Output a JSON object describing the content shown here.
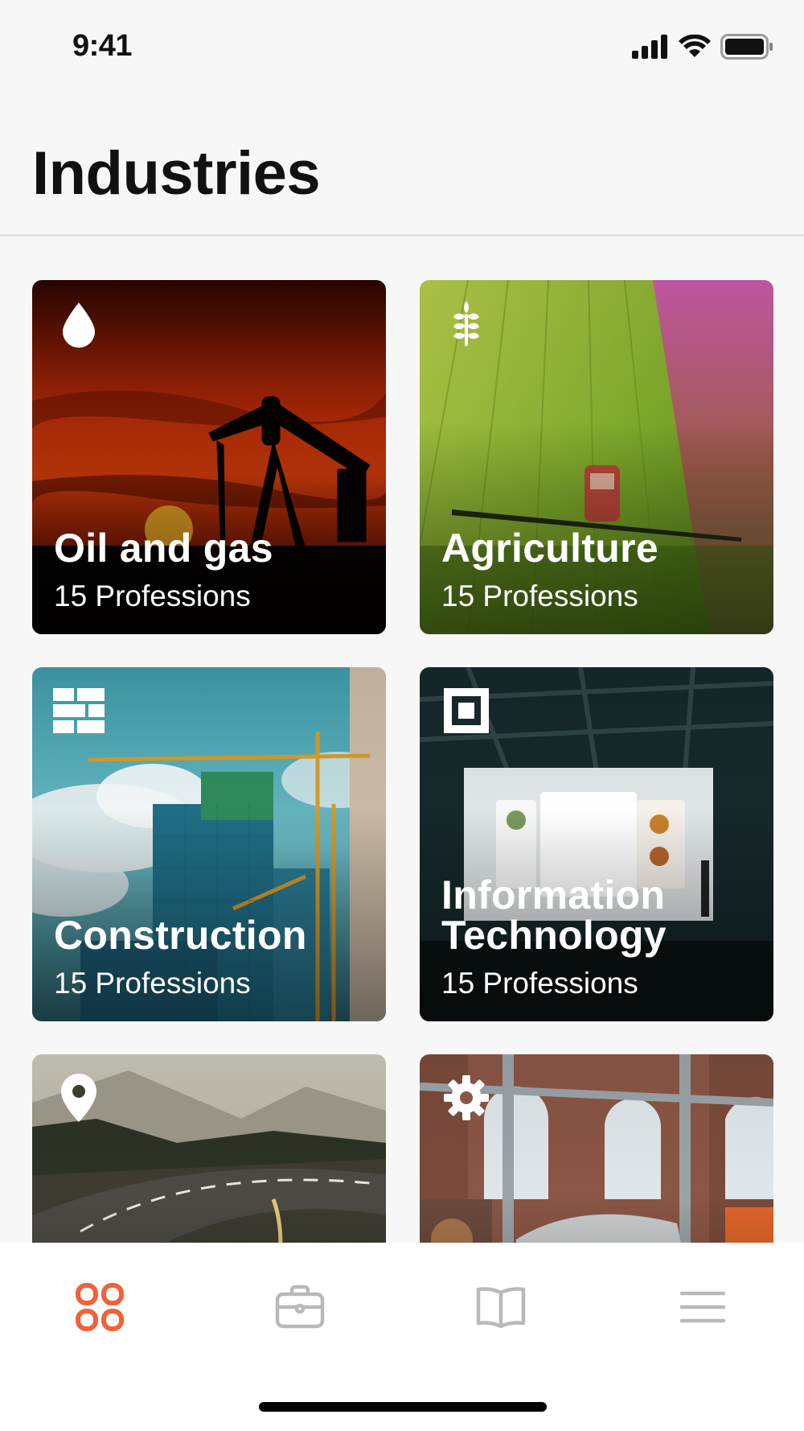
{
  "status_bar": {
    "time": "9:41"
  },
  "header": {
    "title": "Industries"
  },
  "industries": [
    {
      "name": "Oil and gas",
      "count": "15 Professions",
      "icon": "drop-icon"
    },
    {
      "name": "Agriculture",
      "count": "15 Professions",
      "icon": "wheat-icon"
    },
    {
      "name": "Construction",
      "count": "15 Professions",
      "icon": "bricks-icon"
    },
    {
      "name": "Information Technology",
      "count": "15 Professions",
      "icon": "square-chip-icon"
    },
    {
      "name": "",
      "count": "",
      "icon": "location-pin-icon"
    },
    {
      "name": "",
      "count": "",
      "icon": "gear-icon"
    }
  ],
  "tab_bar": {
    "tabs": [
      {
        "icon": "grid-icon",
        "active": true
      },
      {
        "icon": "briefcase-icon",
        "active": false
      },
      {
        "icon": "book-icon",
        "active": false
      },
      {
        "icon": "menu-icon",
        "active": false
      }
    ]
  },
  "colors": {
    "accent": "#f2613a",
    "inactive": "#b9b9b9",
    "background": "#f7f7f7"
  }
}
